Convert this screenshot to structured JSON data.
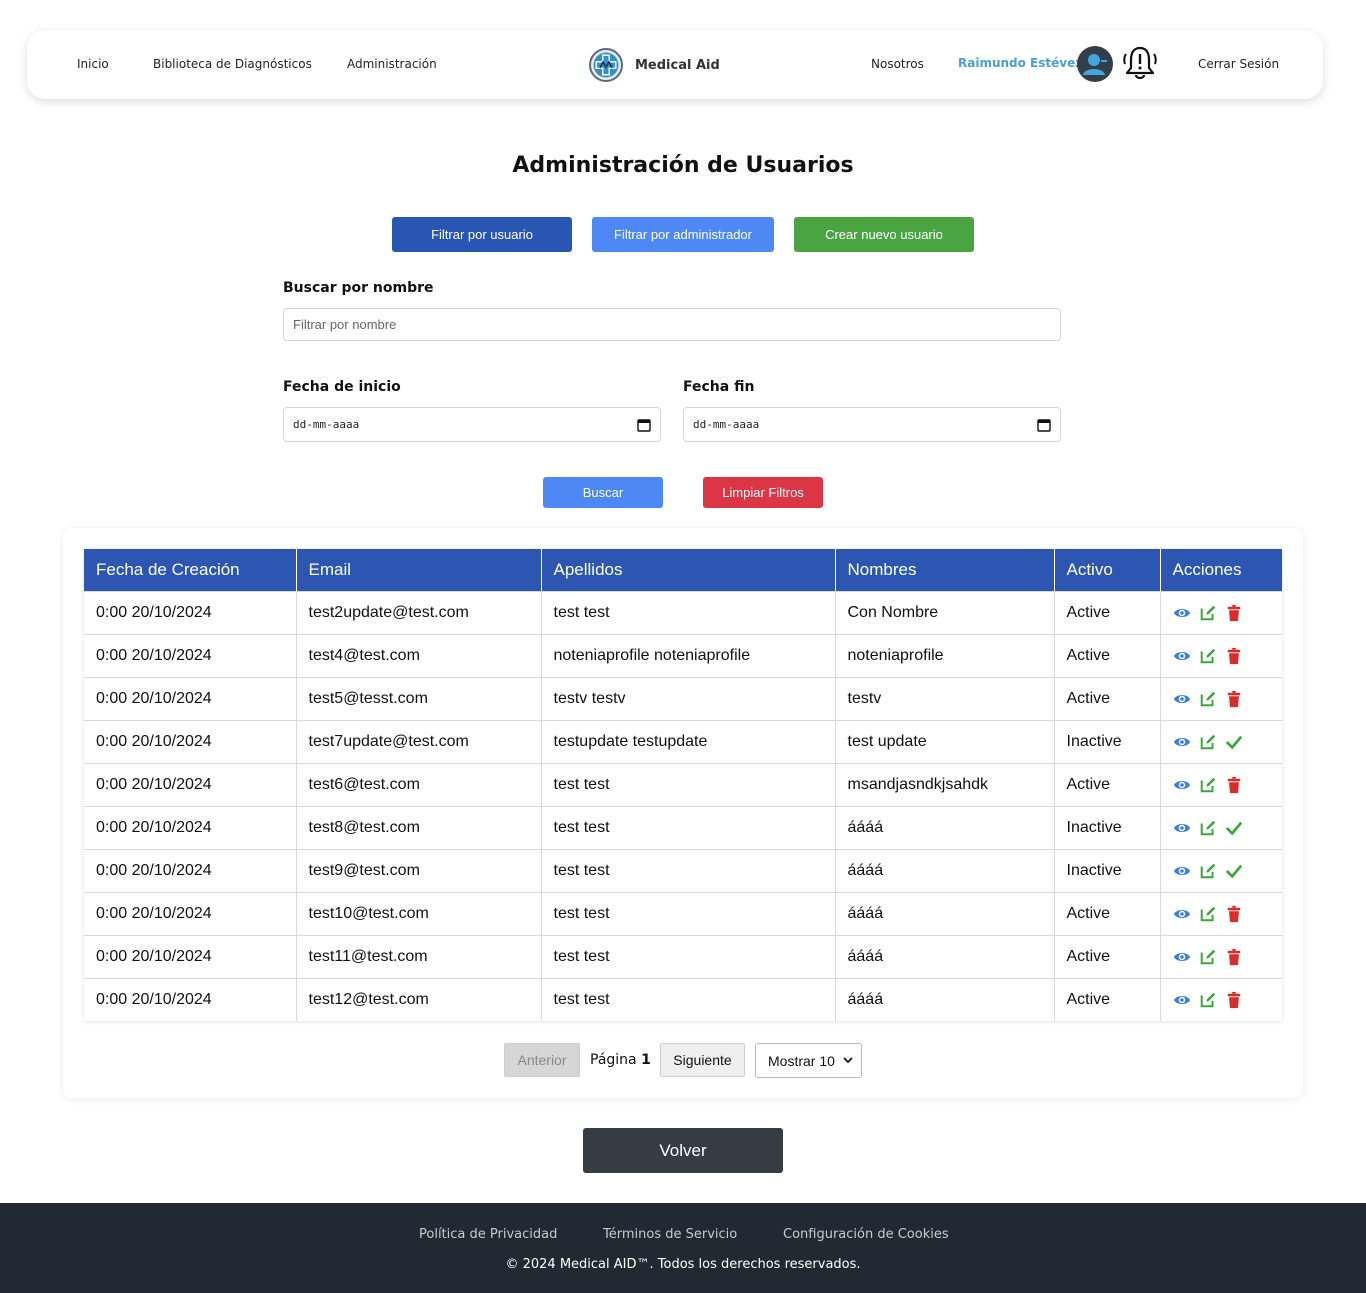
{
  "nav": {
    "links": [
      "Inicio",
      "Biblioteca de Diagnósticos",
      "Administración"
    ],
    "brand": "Medical Aid",
    "about": "Nosotros",
    "user_name": "Raimundo Estévez",
    "logout": "Cerrar Sesión"
  },
  "page_title": "Administración de Usuarios",
  "filters": {
    "by_user": "Filtrar por usuario",
    "by_admin": "Filtrar por administrador",
    "create_user": "Crear nuevo usuario",
    "search_label": "Buscar por nombre",
    "search_placeholder": "Filtrar por nombre",
    "start_label": "Fecha de inicio",
    "end_label": "Fecha fin",
    "date_placeholder": "dd-mm-aaaa",
    "search_button": "Buscar",
    "clear_button": "Limpiar Filtros"
  },
  "table": {
    "headers": [
      "Fecha de Creación",
      "Email",
      "Apellidos",
      "Nombres",
      "Activo",
      "Acciones"
    ],
    "rows": [
      {
        "date": "0:00 20/10/2024",
        "email": "test2update@test.com",
        "surname": "test test",
        "name": "Con Nombre",
        "status": "Active"
      },
      {
        "date": "0:00 20/10/2024",
        "email": "test4@test.com",
        "surname": "noteniaprofile noteniaprofile",
        "name": "noteniaprofile",
        "status": "Active"
      },
      {
        "date": "0:00 20/10/2024",
        "email": "test5@tesst.com",
        "surname": "testv testv",
        "name": "testv",
        "status": "Active"
      },
      {
        "date": "0:00 20/10/2024",
        "email": "test7update@test.com",
        "surname": "testupdate testupdate",
        "name": "test update",
        "status": "Inactive"
      },
      {
        "date": "0:00 20/10/2024",
        "email": "test6@test.com",
        "surname": "test test",
        "name": "msandjasndkjsahdk",
        "status": "Active"
      },
      {
        "date": "0:00 20/10/2024",
        "email": "test8@test.com",
        "surname": "test test",
        "name": "áááá",
        "status": "Inactive"
      },
      {
        "date": "0:00 20/10/2024",
        "email": "test9@test.com",
        "surname": "test test",
        "name": "áááá",
        "status": "Inactive"
      },
      {
        "date": "0:00 20/10/2024",
        "email": "test10@test.com",
        "surname": "test test",
        "name": "áááá",
        "status": "Active"
      },
      {
        "date": "0:00 20/10/2024",
        "email": "test11@test.com",
        "surname": "test test",
        "name": "áááá",
        "status": "Active"
      },
      {
        "date": "0:00 20/10/2024",
        "email": "test12@test.com",
        "surname": "test test",
        "name": "áááá",
        "status": "Active"
      }
    ]
  },
  "pagination": {
    "prev": "Anterior",
    "page_label": "Página",
    "page_number": "1",
    "next": "Siguiente",
    "page_size": "Mostrar 10"
  },
  "back_button": "Volver",
  "footer": {
    "links": [
      "Política de Privacidad",
      "Términos de Servicio",
      "Configuración de Cookies"
    ],
    "copyright": "© 2024 Medical AID™. Todos los derechos reservados."
  },
  "colors": {
    "primary_dark": "#2a56b3",
    "primary": "#4d88f5",
    "success": "#4aa441",
    "danger": "#dc3545",
    "footer_bg": "#212932",
    "view_icon": "#3d7fe0",
    "edit_icon": "#3aa73b",
    "delete_icon": "#d62d2d"
  },
  "icons": {
    "row_actions_active": [
      "eye-icon",
      "edit-icon",
      "trash-icon"
    ],
    "row_actions_inactive": [
      "eye-icon",
      "edit-icon",
      "check-icon"
    ]
  }
}
